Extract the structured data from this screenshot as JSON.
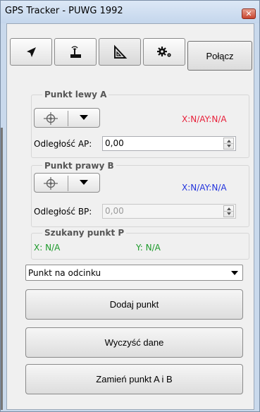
{
  "window": {
    "title": "GPS Tracker - PUWG 1992",
    "close_glyph": "✕"
  },
  "toolbar": {
    "tabs": [
      {
        "icon": "navigation-arrow-icon"
      },
      {
        "icon": "gps-receiver-icon"
      },
      {
        "icon": "triangle-ruler-icon"
      },
      {
        "icon": "settings-gears-icon"
      }
    ],
    "connect_label": "Połącz"
  },
  "point_a": {
    "title": "Punkt lewy A",
    "coords": "X:N/AY:N/A",
    "coords_color": "#e8203a",
    "distance_label": "Odległość AP:",
    "distance_value": "0,00"
  },
  "point_b": {
    "title": "Punkt prawy B",
    "coords": "X:N/AY:N/A",
    "coords_color": "#2233dd",
    "distance_label": "Odległość BP:",
    "distance_value": "0,00"
  },
  "point_p": {
    "title": "Szukany punkt P",
    "x_text": "X: N/A",
    "y_text": "Y: N/A",
    "color": "#1c9a2a"
  },
  "mode_select": {
    "selected": "Punkt na odcinku"
  },
  "actions": {
    "add_point": "Dodaj punkt",
    "clear_data": "Wyczyść dane",
    "swap_points": "Zamień punkt A i B"
  }
}
